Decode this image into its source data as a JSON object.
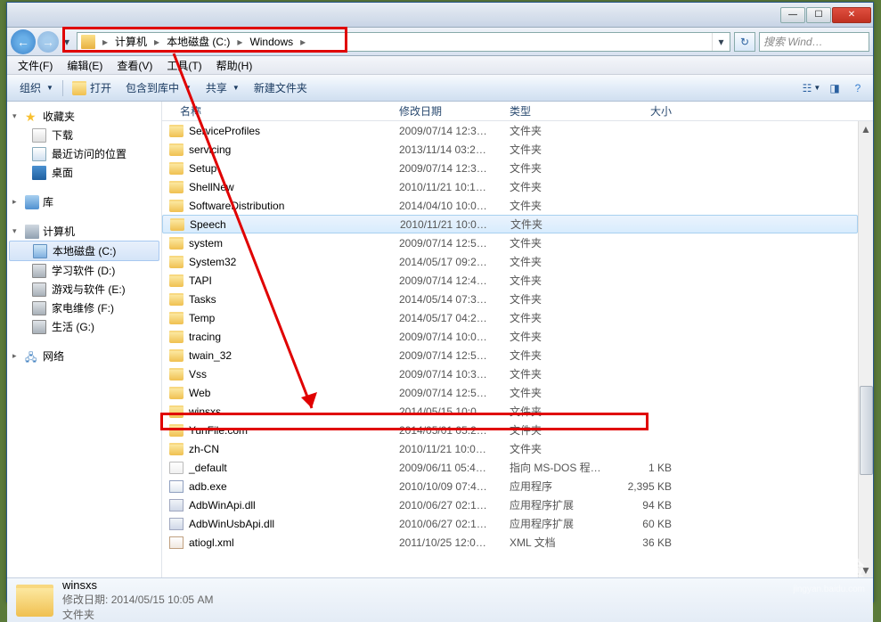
{
  "window_controls": {
    "min": "—",
    "max": "☐",
    "close": "✕"
  },
  "nav": {
    "back": "←",
    "forward": "→",
    "dd": "▾"
  },
  "breadcrumb": {
    "sep": "▸",
    "items": [
      "计算机",
      "本地磁盘 (C:)",
      "Windows"
    ]
  },
  "search": {
    "placeholder": "搜索 Wind…"
  },
  "refresh_glyph": "↻",
  "addr_dd": "▾",
  "menu": [
    "文件(F)",
    "编辑(E)",
    "查看(V)",
    "工具(T)",
    "帮助(H)"
  ],
  "toolbar": {
    "organize": "组织",
    "open": "打开",
    "include": "包含到库中",
    "share": "共享",
    "newfolder": "新建文件夹"
  },
  "nav_pane": {
    "favorites": {
      "label": "收藏夹",
      "items": [
        "下载",
        "最近访问的位置",
        "桌面"
      ]
    },
    "libraries": {
      "label": "库"
    },
    "computer": {
      "label": "计算机",
      "drives": [
        "本地磁盘 (C:)",
        "学习软件 (D:)",
        "游戏与软件 (E:)",
        "家电维修 (F:)",
        "生活 (G:)"
      ]
    },
    "network": {
      "label": "网络"
    }
  },
  "columns": {
    "name": "名称",
    "date": "修改日期",
    "type": "类型",
    "size": "大小"
  },
  "files": [
    {
      "icon": "folder",
      "name": "ServiceProfiles",
      "date": "2009/07/14 12:3…",
      "type": "文件夹",
      "size": ""
    },
    {
      "icon": "folder",
      "name": "servicing",
      "date": "2013/11/14 03:2…",
      "type": "文件夹",
      "size": ""
    },
    {
      "icon": "folder",
      "name": "Setup",
      "date": "2009/07/14 12:3…",
      "type": "文件夹",
      "size": ""
    },
    {
      "icon": "folder",
      "name": "ShellNew",
      "date": "2010/11/21 10:1…",
      "type": "文件夹",
      "size": ""
    },
    {
      "icon": "folder",
      "name": "SoftwareDistribution",
      "date": "2014/04/10 10:0…",
      "type": "文件夹",
      "size": ""
    },
    {
      "icon": "folder",
      "name": "Speech",
      "date": "2010/11/21 10:0…",
      "type": "文件夹",
      "size": "",
      "selected": true
    },
    {
      "icon": "folder",
      "name": "system",
      "date": "2009/07/14 12:5…",
      "type": "文件夹",
      "size": ""
    },
    {
      "icon": "folder",
      "name": "System32",
      "date": "2014/05/17 09:2…",
      "type": "文件夹",
      "size": ""
    },
    {
      "icon": "folder",
      "name": "TAPI",
      "date": "2009/07/14 12:4…",
      "type": "文件夹",
      "size": ""
    },
    {
      "icon": "folder",
      "name": "Tasks",
      "date": "2014/05/14 07:3…",
      "type": "文件夹",
      "size": ""
    },
    {
      "icon": "folder",
      "name": "Temp",
      "date": "2014/05/17 04:2…",
      "type": "文件夹",
      "size": ""
    },
    {
      "icon": "folder",
      "name": "tracing",
      "date": "2009/07/14 10:0…",
      "type": "文件夹",
      "size": ""
    },
    {
      "icon": "folder",
      "name": "twain_32",
      "date": "2009/07/14 12:5…",
      "type": "文件夹",
      "size": ""
    },
    {
      "icon": "folder",
      "name": "Vss",
      "date": "2009/07/14 10:3…",
      "type": "文件夹",
      "size": ""
    },
    {
      "icon": "folder",
      "name": "Web",
      "date": "2009/07/14 12:5…",
      "type": "文件夹",
      "size": ""
    },
    {
      "icon": "folder",
      "name": "winsxs",
      "date": "2014/05/15 10:0…",
      "type": "文件夹",
      "size": "",
      "highlighted": true
    },
    {
      "icon": "folder",
      "name": "YunFile.com",
      "date": "2014/05/01 05:2…",
      "type": "文件夹",
      "size": ""
    },
    {
      "icon": "folder",
      "name": "zh-CN",
      "date": "2010/11/21 10:0…",
      "type": "文件夹",
      "size": ""
    },
    {
      "icon": "file",
      "name": "_default",
      "date": "2009/06/11 05:4…",
      "type": "指向 MS-DOS 程…",
      "size": "1 KB"
    },
    {
      "icon": "exe",
      "name": "adb.exe",
      "date": "2010/10/09 07:4…",
      "type": "应用程序",
      "size": "2,395 KB"
    },
    {
      "icon": "dll",
      "name": "AdbWinApi.dll",
      "date": "2010/06/27 02:1…",
      "type": "应用程序扩展",
      "size": "94 KB"
    },
    {
      "icon": "dll",
      "name": "AdbWinUsbApi.dll",
      "date": "2010/06/27 02:1…",
      "type": "应用程序扩展",
      "size": "60 KB"
    },
    {
      "icon": "xml",
      "name": "atiogl.xml",
      "date": "2011/10/25 12:0…",
      "type": "XML 文档",
      "size": "36 KB"
    }
  ],
  "details": {
    "name": "winsxs",
    "mod_label": "修改日期:",
    "mod_value": "2014/05/15 10:05 AM",
    "type": "文件夹"
  },
  "watermark": "Baidu 经验",
  "watermark_sub": "jingyan.baidu.com"
}
